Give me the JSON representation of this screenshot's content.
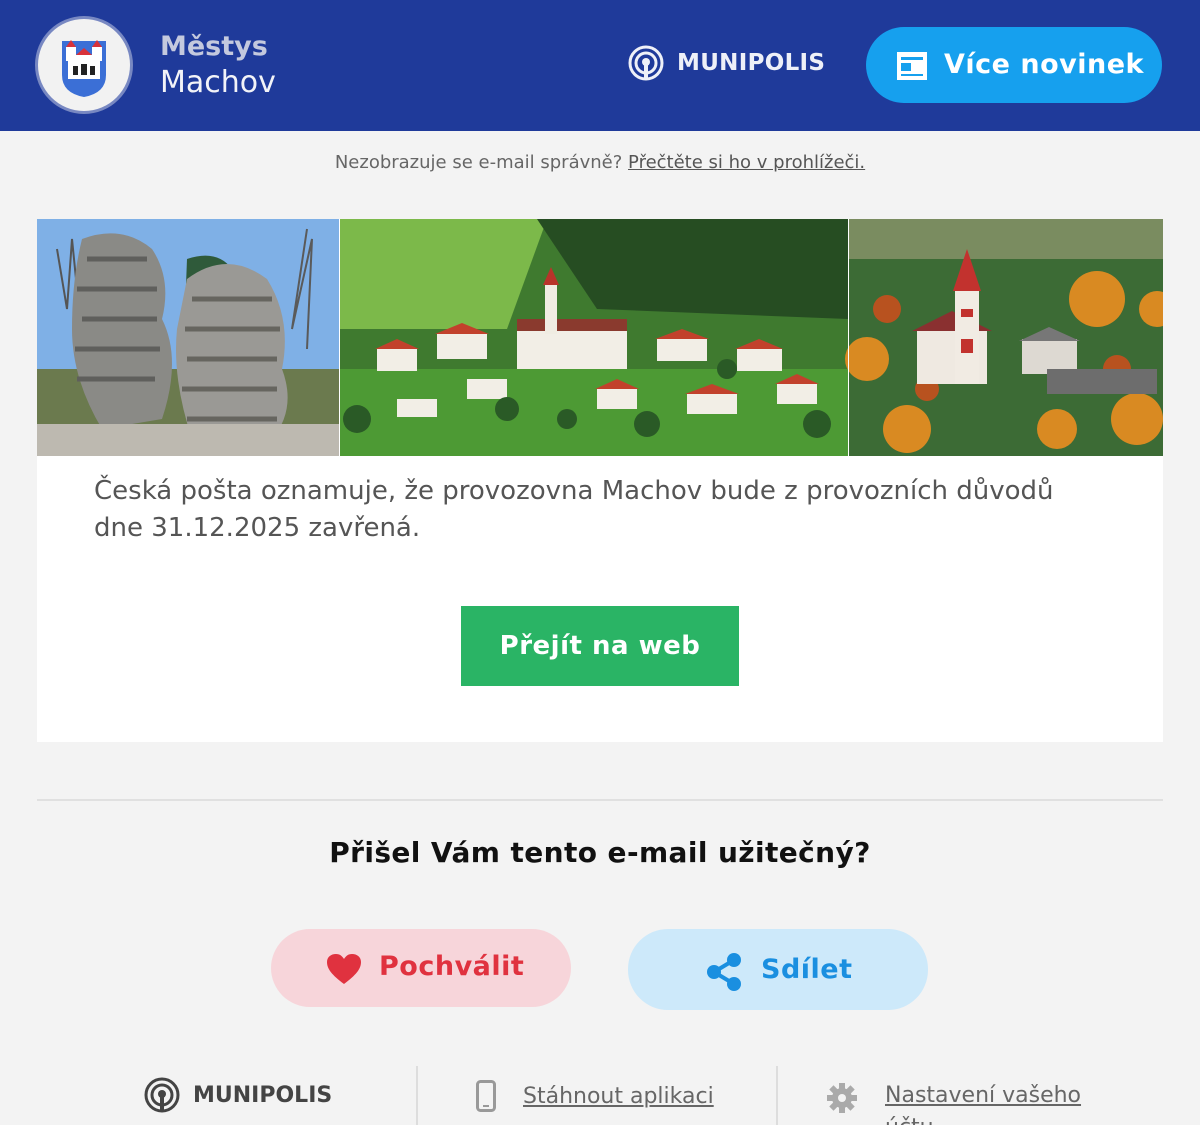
{
  "header": {
    "town_type": "Městys",
    "town_name": "Machov",
    "brand": "MUNIPOLIS",
    "more_news_label": "Více novinek",
    "more_news_icon": "news-icon"
  },
  "notice": {
    "text": "Nezobrazuje se e-mail správně?",
    "link": "Přečtěte si ho v prohlížeči."
  },
  "article": {
    "photos": [
      "rock-formation-photo",
      "village-aerial-photo",
      "church-autumn-photo"
    ],
    "message": "Česká pošta oznamuje, že provozovna Machov bude z provozních důvodů dne 31.12.2025 zavřená.",
    "cta_label": "Přejít na web"
  },
  "feedback": {
    "question": "Přišel Vám tento e-mail užitečný?",
    "praise_label": "Pochválit",
    "share_label": "Sdílet"
  },
  "footer": {
    "brand": "MUNIPOLIS",
    "app_label": "Stáhnout aplikaci",
    "settings_label": "Nastavení vašeho účtu"
  },
  "colors": {
    "header_bg": "#1f3a9a",
    "more_btn": "#16a0ee",
    "cta": "#2ab465",
    "praise_bg": "#f7d5da",
    "praise_text": "#e0323f",
    "share_bg": "#cde9fa",
    "share_text": "#1a8fe0"
  }
}
